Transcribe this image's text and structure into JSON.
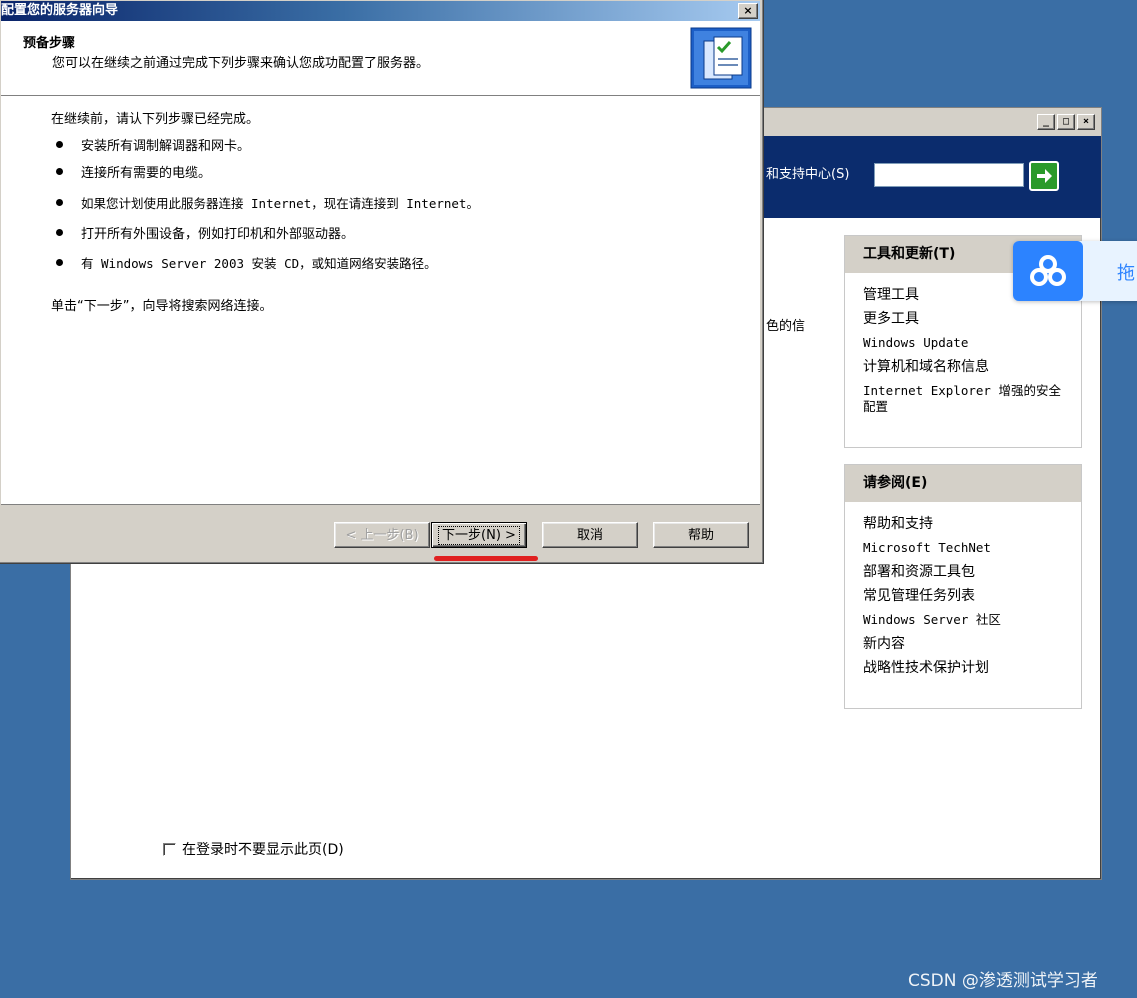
{
  "background_window": {
    "search_label": "和支持中心(S)",
    "left_fragment": "色的信",
    "tools_panel": {
      "title": "工具和更新(T)",
      "items": [
        "管理工具",
        "更多工具",
        "Windows Update",
        "计算机和域名称信息",
        "Internet Explorer 增强的安全配置"
      ]
    },
    "see_also_panel": {
      "title": "请参阅(E)",
      "items": [
        "帮助和支持",
        "Microsoft TechNet",
        "部署和资源工具包",
        "常见管理任务列表",
        "Windows Server 社区",
        "新内容",
        "战略性技术保护计划"
      ]
    },
    "dont_show_label": "在登录时不要显示此页(D)",
    "dont_show_checked": false,
    "window_controls": [
      "_",
      "□",
      "×"
    ]
  },
  "wizard": {
    "title": "配置您的服务器向导",
    "heading": "预备步骤",
    "subheading": "您可以在继续之前通过完成下列步骤来确认您成功配置了服务器。",
    "intro": "在继续前，请认下列步骤已经完成。",
    "steps": [
      "安装所有调制解调器和网卡。",
      "连接所有需要的电缆。",
      "如果您计划使用此服务器连接 Internet，现在请连接到 Internet。",
      "打开所有外围设备，例如打印机和外部驱动器。",
      "有 Windows Server 2003 安装 CD，或知道网络安装路径。"
    ],
    "next_hint": "单击“下一步”，向导将搜索网络连接。",
    "buttons": {
      "back": "< 上一步(B)",
      "next": "下一步(N) >",
      "cancel": "取消",
      "help": "帮助"
    },
    "close": "×"
  },
  "floating_widget": {
    "text": "拖"
  },
  "watermark": "CSDN @渗透测试学习者",
  "colors": {
    "desktop": "#3a6ea5",
    "banner": "#0b2c6d",
    "highlight_underline": "#e02020",
    "widget_accent": "#2c83ff"
  }
}
